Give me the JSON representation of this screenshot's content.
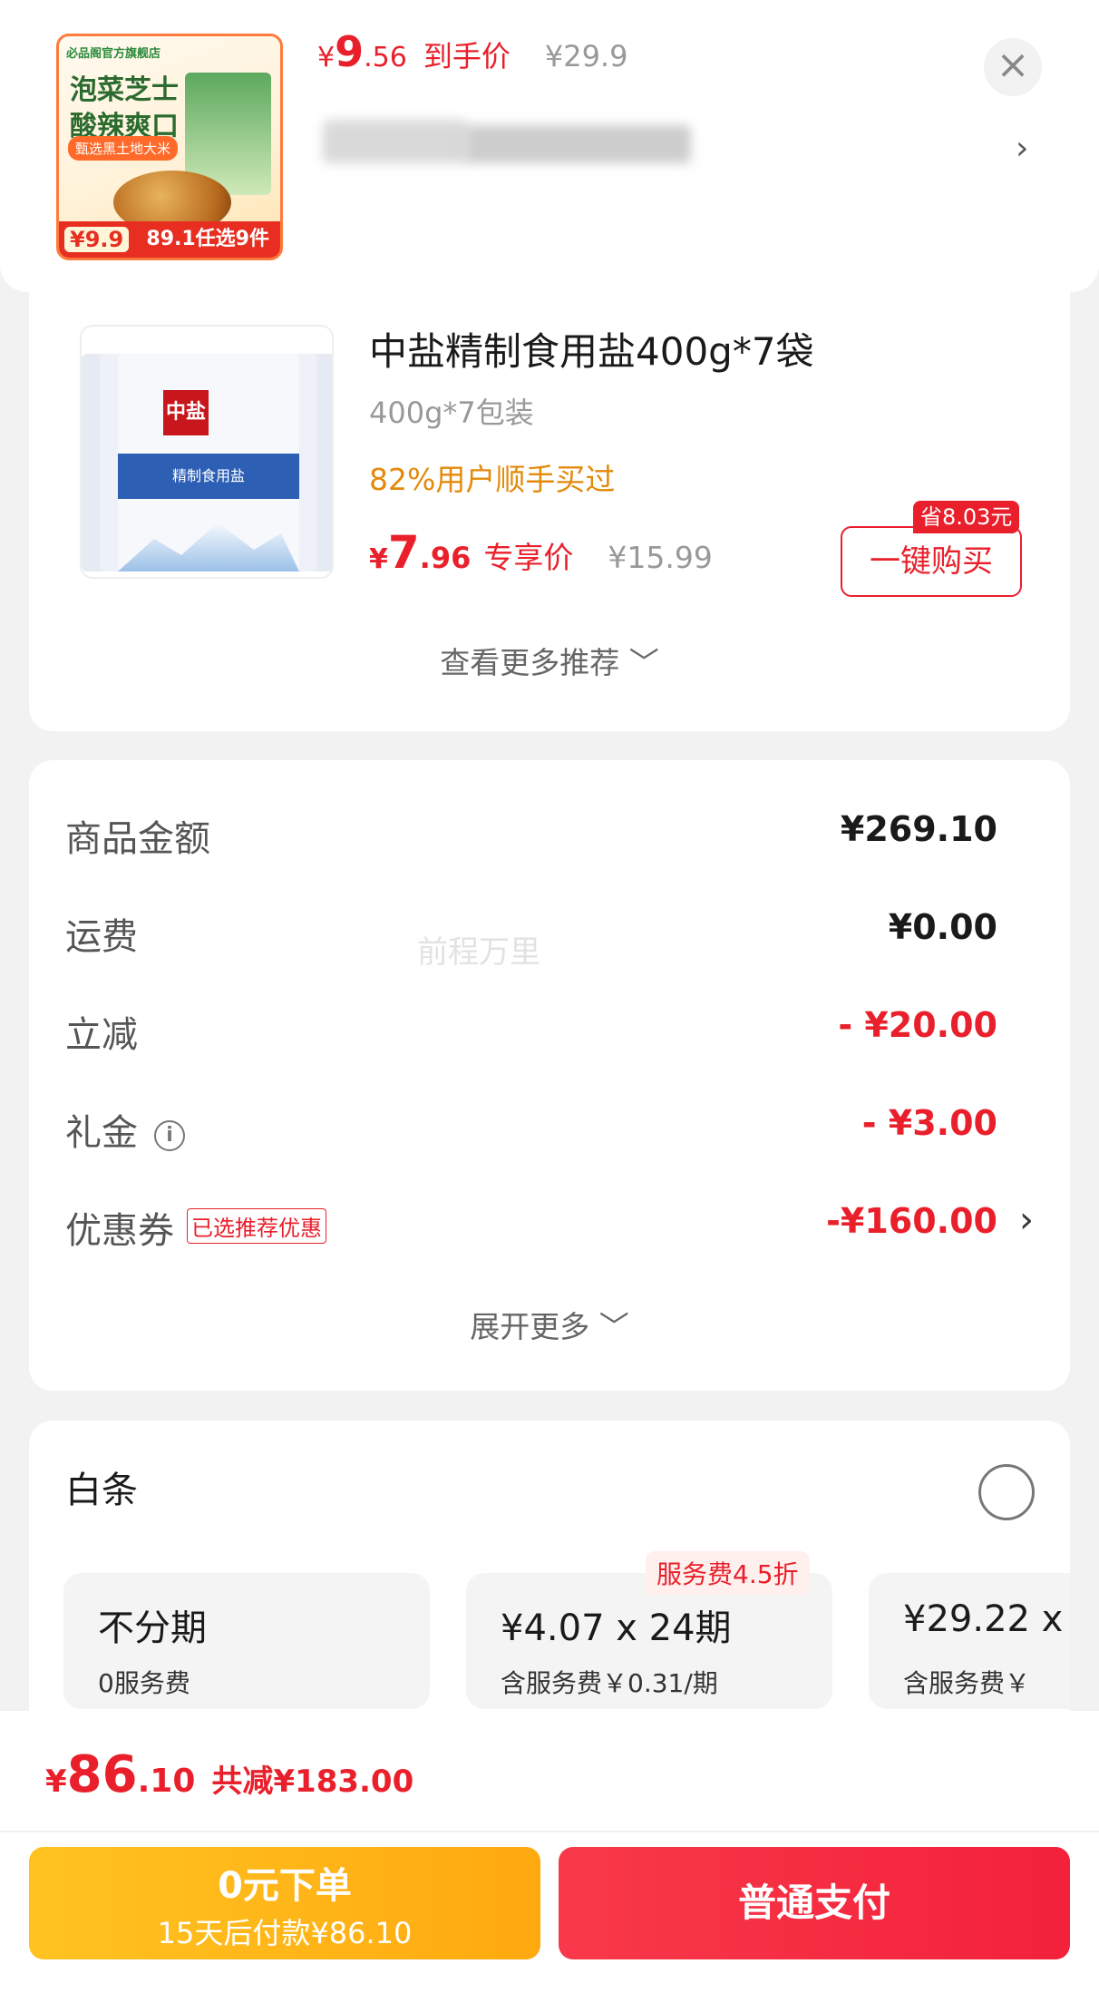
{
  "ad": {
    "shop": "必品阁官方旗舰店",
    "headline1": "泡菜芝士",
    "headline2": "酸辣爽口",
    "badge": "甄选黑土地大米",
    "img_price": "¥9.9",
    "img_offer": "89.1任选9件",
    "price_currency": "¥",
    "price_int": "9",
    "price_dec": ".56",
    "price_tag": "到手价",
    "old_price": "¥29.9",
    "close_icon": "×",
    "chevron": "›"
  },
  "recommend": {
    "brand_logo": "中盐",
    "bag_label": "精制食用盐",
    "title": "中盐精制食用盐400g*7袋",
    "spec": "400g*7包装",
    "bought": "82%用户顺手买过",
    "price_currency": "¥",
    "price_int": "7",
    "price_dec": ".96",
    "price_tag": "专享价",
    "old_price": "¥15.99",
    "save_badge": "省8.03元",
    "buy_button": "一键购买",
    "more": "查看更多推荐 ﹀"
  },
  "amounts": {
    "rows": [
      {
        "label": "商品金额",
        "value": "¥269.10"
      },
      {
        "label": "运费",
        "value": "¥0.00"
      },
      {
        "label": "立减",
        "value": "- ¥20.00"
      },
      {
        "label": "礼金",
        "value": "- ¥3.00"
      },
      {
        "label": "优惠券",
        "value": "-¥160.00",
        "tag": "已选推荐优惠"
      }
    ],
    "expand": "展开更多 ﹀",
    "watermark": "前程万里"
  },
  "baitiao": {
    "title": "白条",
    "plans": [
      {
        "main": "不分期",
        "sub": "0服务费"
      },
      {
        "main": "¥4.07 x 24期",
        "sub": "含服务费￥0.31/期"
      },
      {
        "main": "¥29.22 x",
        "sub": "含服务费￥"
      }
    ],
    "badge": "服务费4.5折"
  },
  "bottom": {
    "total_currency": "¥",
    "total_int": "86",
    "total_dec": ".10",
    "total_save": "共减¥183.00",
    "credit_btn_main": "0元下单",
    "credit_btn_sub": "15天后付款¥86.10",
    "pay_btn": "普通支付"
  },
  "colors": {
    "accent_red": "#e9202b",
    "credit_yellow": "#ffb316",
    "bought_orange": "#e38a0b"
  }
}
